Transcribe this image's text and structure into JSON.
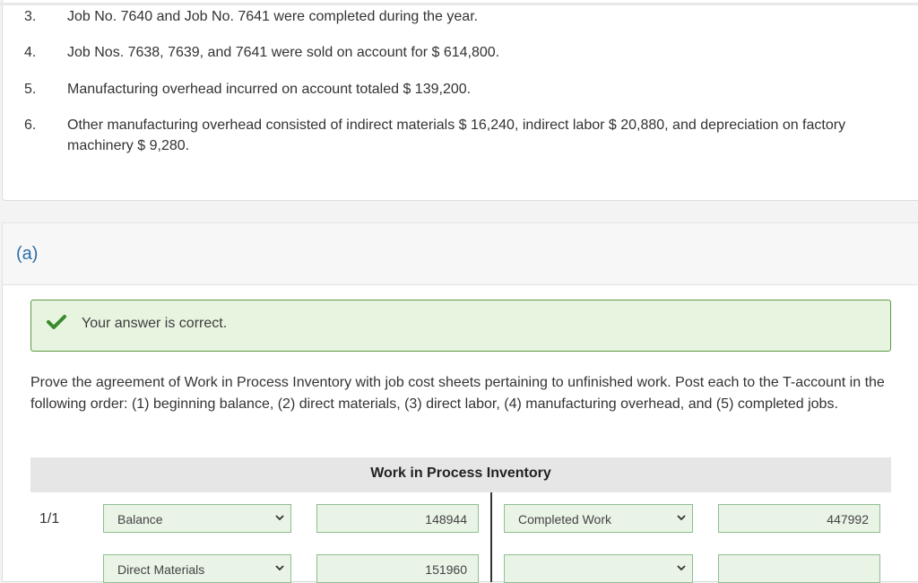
{
  "problem": {
    "items": [
      {
        "num": "3.",
        "text": "Job No. 7640 and Job No. 7641 were completed during the year."
      },
      {
        "num": "4.",
        "text": "Job Nos. 7638, 7639, and 7641 were sold on account for $ 614,800."
      },
      {
        "num": "5.",
        "text": "Manufacturing overhead incurred on account totaled $ 139,200."
      },
      {
        "num": "6.",
        "text": "Other manufacturing overhead consisted of indirect materials $ 16,240, indirect labor $ 20,880, and depreciation on factory machinery $ 9,280."
      }
    ]
  },
  "part": {
    "label": "(a)"
  },
  "feedback": {
    "message": "Your answer is correct.",
    "color": "#3a8a2c"
  },
  "instructions": "Prove the agreement of Work in Process Inventory with job cost sheets pertaining to unfinished work. Post each to the T-account in the following order: (1) beginning balance, (2) direct materials, (3) direct labor, (4) manufacturing overhead, and (5) completed jobs.",
  "t_account": {
    "title": "Work in Process Inventory",
    "rows": [
      {
        "date": "1/1",
        "debit_select": "Balance",
        "debit_amount": "148944",
        "credit_select": "Completed Work",
        "credit_amount": "447992"
      },
      {
        "date": "",
        "debit_select": "Direct Materials",
        "debit_amount": "151960",
        "credit_select": "",
        "credit_amount": ""
      }
    ]
  }
}
